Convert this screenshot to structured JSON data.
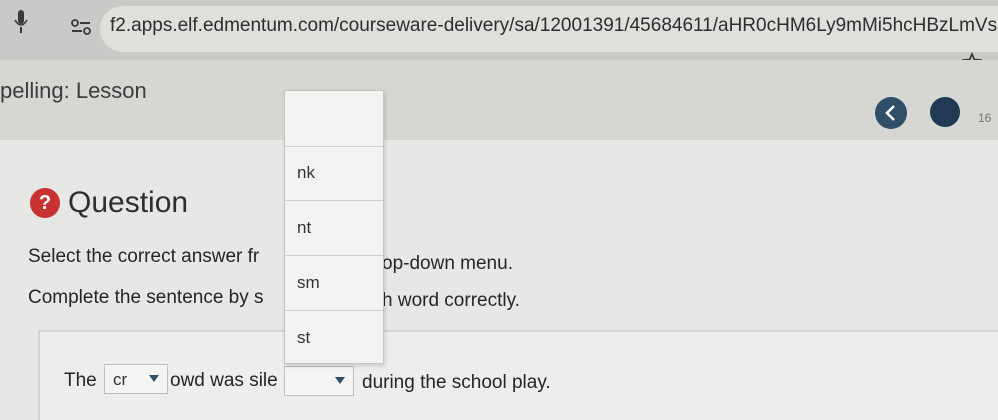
{
  "browser": {
    "url": "f2.apps.elf.edmentum.com/courseware-delivery/sa/12001391/45684611/aHR0cHM6Ly9mMi5hcHBzLmVs",
    "icons": [
      "mic-icon",
      "site-info-icon",
      "star-icon"
    ]
  },
  "lesson": {
    "title": "pelling: Lesson",
    "page_counter": "16"
  },
  "question": {
    "heading": "Question",
    "help_glyph": "?",
    "instruction_1_start": "Select the correct answer fr",
    "instruction_1_end": "op-down menu.",
    "instruction_2_start": "Complete the sentence by s",
    "instruction_2_end": "h word correctly."
  },
  "sentence": {
    "part_1": "The",
    "select_1_value": "cr",
    "part_2": "owd was sile",
    "select_2_value": "",
    "part_3": "during the school play."
  },
  "dropdown": {
    "options": [
      "",
      "nk",
      "nt",
      "sm",
      "st"
    ]
  },
  "colors": {
    "accent": "#2f4f68",
    "help": "#c83232"
  }
}
